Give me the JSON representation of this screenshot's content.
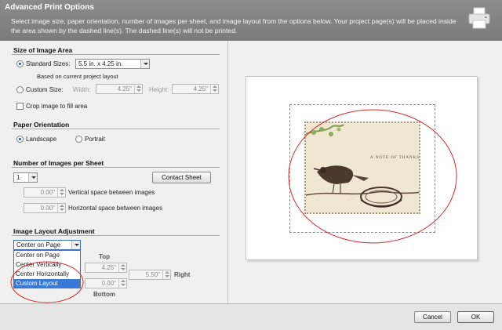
{
  "header": {
    "title": "Advanced Print Options",
    "description": "Select image size, paper orientation, number of images per sheet, and image layout from the options below. Your project page(s) will be placed inside the area shown by the dashed line(s). The dashed line(s) will not be printed.",
    "icon": "printer-icon"
  },
  "size_area": {
    "title": "Size of Image Area",
    "standard_label": "Standard Sizes:",
    "standard_value": "5.5 in. x 4.25 in.",
    "standard_note": "Based on current project layout",
    "custom_label": "Custom Size:",
    "width_label": "Width:",
    "width_value": "4.25\"",
    "height_label": "Height:",
    "height_value": "4.25\"",
    "crop_label": "Crop image to fill area"
  },
  "orientation": {
    "title": "Paper Orientation",
    "landscape": "Landscape",
    "portrait": "Portrait",
    "selected": "Landscape"
  },
  "images_per_sheet": {
    "title": "Number of Images per Sheet",
    "count": "1",
    "contact_sheet": "Contact Sheet",
    "vertical_value": "0.00\"",
    "vertical_label": "Vertical space between images",
    "horizontal_value": "0.00\"",
    "horizontal_label": "Horizontal space between images"
  },
  "layout": {
    "title": "Image Layout Adjustment",
    "selected": "Center on Page",
    "options": [
      "Center on Page",
      "Center Vertically",
      "Center Horizontally",
      "Custom Layout"
    ],
    "highlighted": "Custom Layout",
    "top_label": "Top",
    "top_value": "4.25\"",
    "right_label": "Right",
    "right_value": "5.50\"",
    "bottom_label": "Bottom",
    "bottom_value": "0.00\""
  },
  "preview": {
    "card_text": "A NOTE OF THANKS"
  },
  "footer": {
    "cancel": "Cancel",
    "ok": "OK"
  },
  "colors": {
    "header_bg": "#808080",
    "highlight": "#3a78d6",
    "annotation_red": "#d22a2a"
  }
}
